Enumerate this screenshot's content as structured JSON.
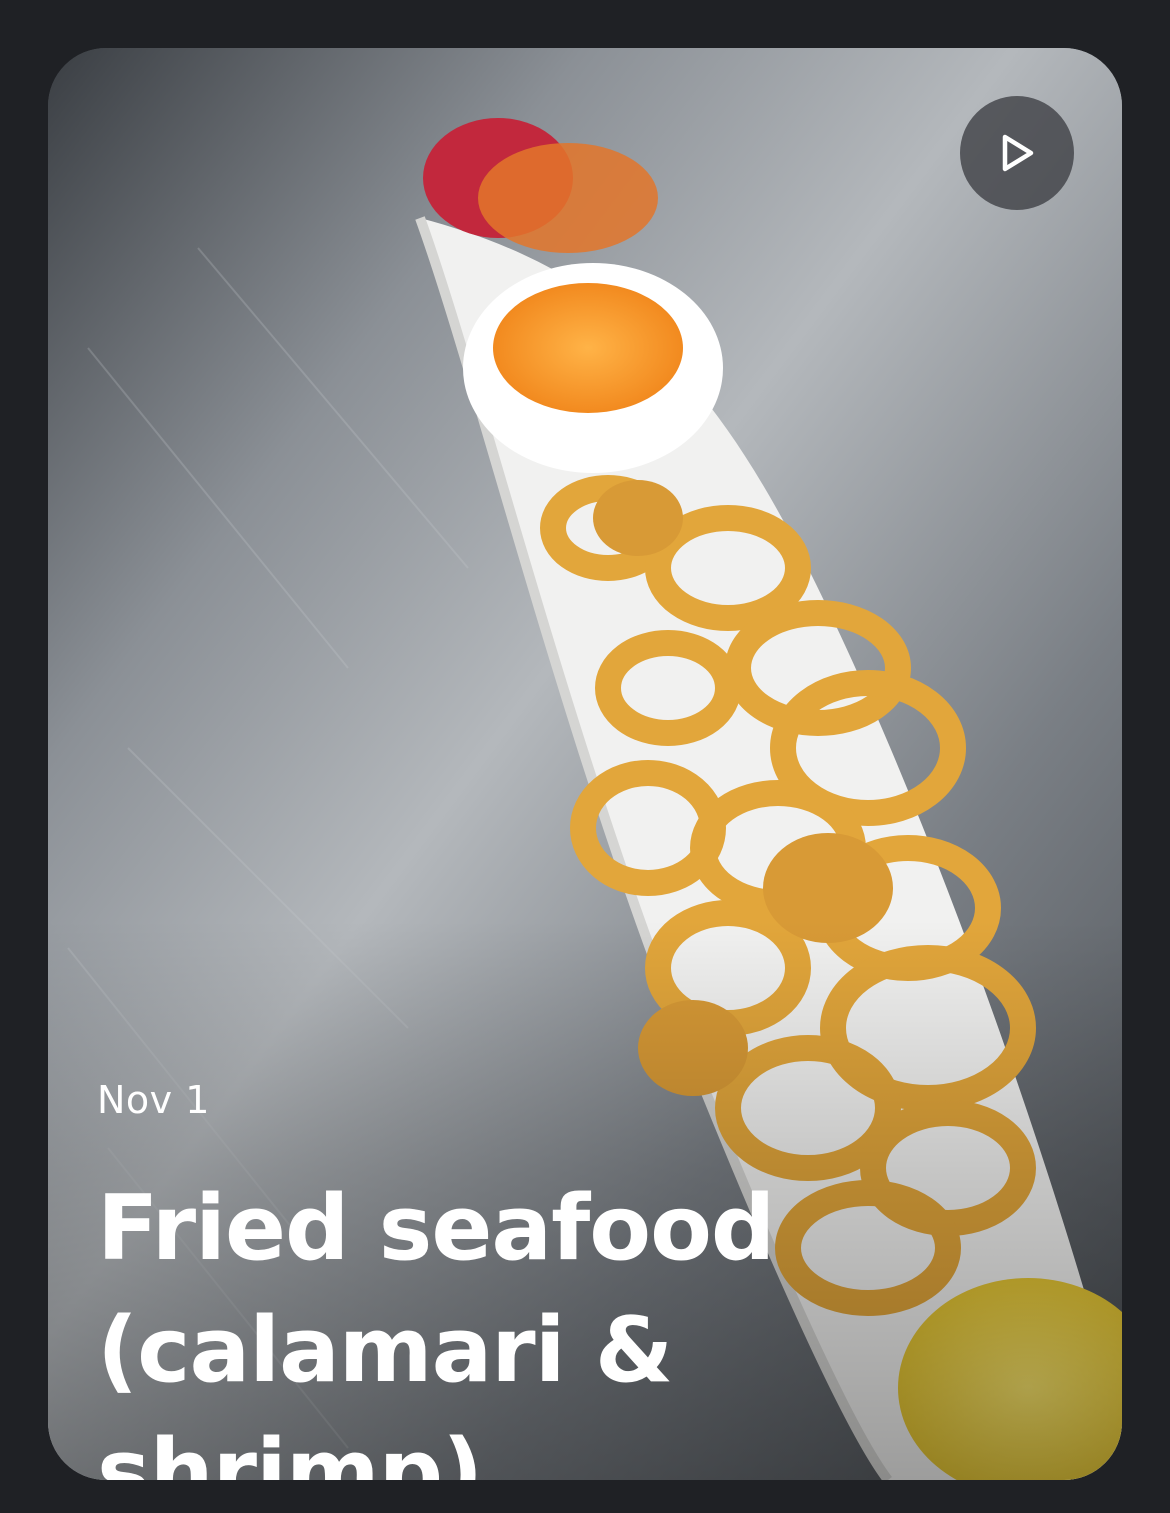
{
  "card": {
    "date": "Nov 1",
    "title": "Fried seafood (calamari & shrimp)",
    "play_icon": "play-icon",
    "image_description_icon": "food-photo"
  },
  "colors": {
    "page_background": "#1f2125",
    "text": "#ffffff",
    "play_button_bg": "#3c3e42"
  }
}
